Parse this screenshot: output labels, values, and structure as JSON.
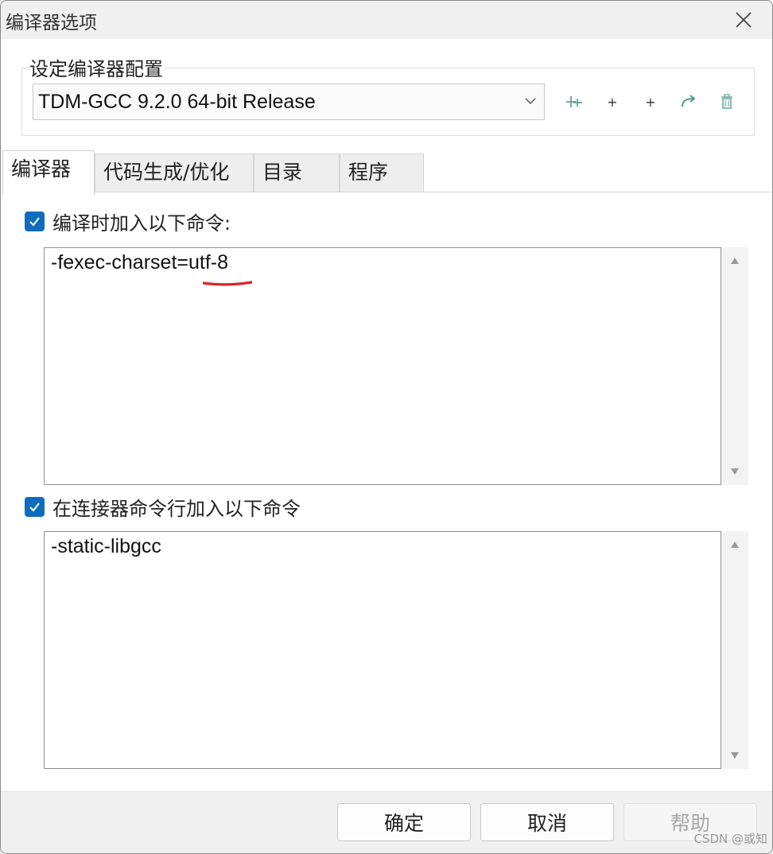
{
  "window": {
    "title": "编译器选项",
    "close_icon": "close-icon"
  },
  "config_group": {
    "legend": "设定编译器配置",
    "selected_compiler": "TDM-GCC 9.2.0 64-bit Release",
    "toolbar_icons": [
      "add-compilers-icon",
      "add-icon",
      "add-icon",
      "rename-icon",
      "delete-icon"
    ],
    "toolbar_labels": [
      "+",
      "+",
      "+"
    ]
  },
  "tabs": [
    {
      "label": "编译器",
      "active": true
    },
    {
      "label": "代码生成/优化",
      "active": false
    },
    {
      "label": "目录",
      "active": false
    },
    {
      "label": "程序",
      "active": false
    }
  ],
  "compiler_tab": {
    "compile_commands": {
      "checked": true,
      "label": "编译时加入以下命令:",
      "value": "-fexec-charset=utf-8"
    },
    "linker_commands": {
      "checked": true,
      "label": "在连接器命令行加入以下命令",
      "value": "-static-libgcc"
    }
  },
  "footer": {
    "ok_label": "确定",
    "cancel_label": "取消",
    "help_label": "帮助"
  },
  "watermark": "CSDN @或知",
  "colors": {
    "accent": "#0f6cbd",
    "annotation": "#e0242b"
  }
}
